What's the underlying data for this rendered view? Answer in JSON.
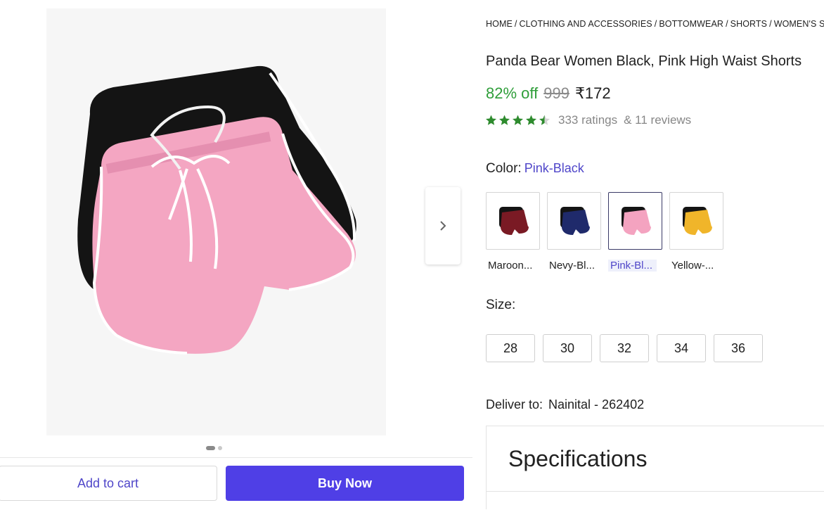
{
  "breadcrumb": [
    "HOME",
    "CLOTHING AND ACCESSORIES",
    "BOTTOMWEAR",
    "SHORTS",
    "WOMEN'S SHORTS"
  ],
  "product": {
    "title": "Panda Bear Women Black, Pink High Waist Shorts",
    "discount": "82% off",
    "mrp": "999",
    "price": "₹172",
    "rating_value": 4.5,
    "ratings_text": "333 ratings",
    "reviews_text": "& 11 reviews"
  },
  "color": {
    "label": "Color:",
    "selected": "Pink-Black",
    "options": [
      {
        "name": "Maroon...",
        "main": "#7a1a24"
      },
      {
        "name": "Nevy-Bl...",
        "main": "#1f2a6b"
      },
      {
        "name": "Pink-Bl...",
        "main": "#f4a3c0"
      },
      {
        "name": "Yellow-...",
        "main": "#f0b52a"
      }
    ]
  },
  "size": {
    "label": "Size:",
    "options": [
      "28",
      "30",
      "32",
      "34",
      "36"
    ]
  },
  "delivery": {
    "label": "Deliver to:",
    "location": "Nainital - 262402"
  },
  "specifications": {
    "heading": "Specifications"
  },
  "actions": {
    "add_to_cart": "Add to cart",
    "buy_now": "Buy Now"
  },
  "gallery": {
    "current_index": 1,
    "total": 2
  },
  "colors": {
    "accent": "#4f3fe6",
    "discount_green": "#2f9e3a",
    "star_green": "#2e8b2e",
    "link_purple": "#4f46c9"
  }
}
